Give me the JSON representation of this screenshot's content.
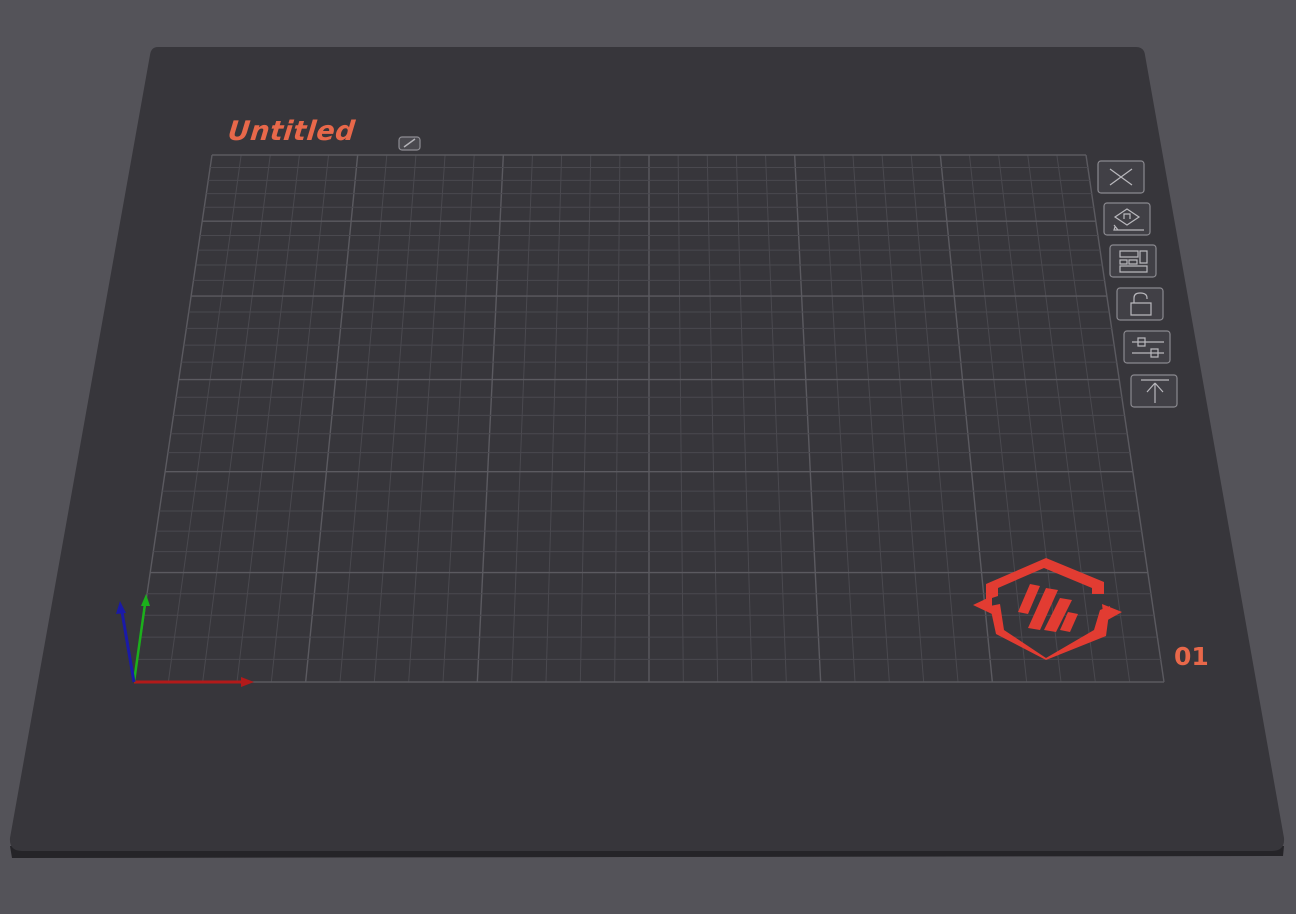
{
  "plate": {
    "name": "Untitled",
    "number": "01"
  },
  "toolbar": [
    {
      "id": "delete-plate",
      "icon": "close-x-icon"
    },
    {
      "id": "arrange-plate",
      "icon": "auto-arrange-icon"
    },
    {
      "id": "orient-plate",
      "icon": "layout-objects-icon"
    },
    {
      "id": "lock-plate",
      "icon": "unlock-icon"
    },
    {
      "id": "plate-settings",
      "icon": "sliders-icon"
    },
    {
      "id": "move-to-top",
      "icon": "move-to-top-icon"
    }
  ],
  "colors": {
    "background": "#545359",
    "plate": "#37363b",
    "plate_edge": "#252428",
    "grid_minor": "#4a494f",
    "grid_major": "#5b5a60",
    "accent": "#e8684a",
    "logo": "#e23c32",
    "axis_x": "#b31a1a",
    "axis_y": "#1bb01b",
    "axis_z": "#1a1aa8"
  }
}
